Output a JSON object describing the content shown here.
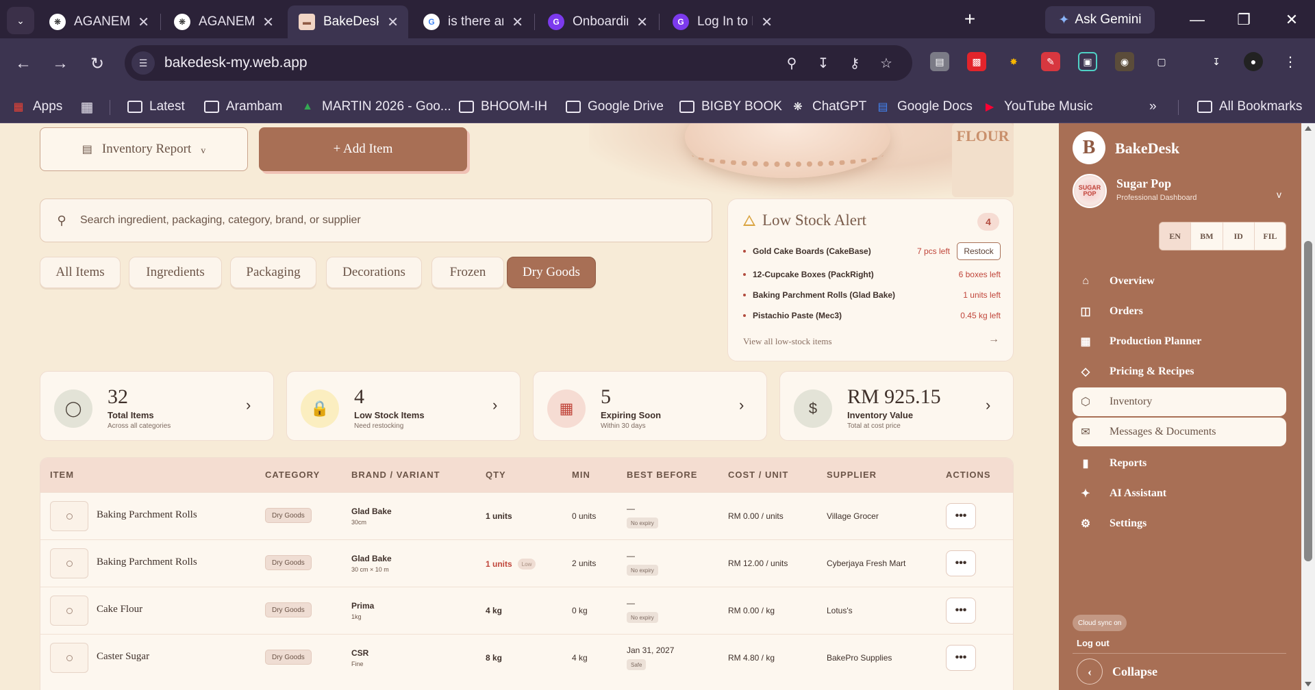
{
  "browser": {
    "tabs": [
      {
        "label": "AGANEM - LAT",
        "favicon": "chatgpt-icon"
      },
      {
        "label": "AGANEM - TH",
        "favicon": "chatgpt-icon"
      },
      {
        "label": "BakeDesk: Bak",
        "favicon": "bakedesk-icon"
      },
      {
        "label": "is there any ai",
        "favicon": "google-icon"
      },
      {
        "label": "Onboarding | C",
        "favicon": "g-icon"
      },
      {
        "label": "Log In to Bake",
        "favicon": "g-icon"
      }
    ],
    "ask_gemini": "Ask Gemini",
    "url": "bakedesk-my.web.app",
    "bookmarks": [
      "Apps",
      "Latest",
      "Arambam",
      "MARTIN 2026 - Goo...",
      "BHOOM-IH",
      "Google Drive",
      "BIGBY BOOK",
      "ChatGPT",
      "Google Docs",
      "YouTube Music",
      "All Bookmarks"
    ]
  },
  "toolbar": {
    "report_label": "Inventory Report",
    "report_caret": "v",
    "add_label": "+ Add Item"
  },
  "hero": {
    "flour_text": "FLOUR"
  },
  "search": {
    "placeholder": "Search ingredient, packaging, category, brand, or supplier"
  },
  "filters": [
    "All Items",
    "Ingredients",
    "Packaging",
    "Decorations",
    "Frozen",
    "Dry Goods"
  ],
  "active_filter": "Dry Goods",
  "low_stock": {
    "title": "Low Stock Alert",
    "count": "4",
    "items": [
      {
        "name": "Gold Cake Boards (CakeBase)",
        "qty": "7 pcs left",
        "action": "Restock"
      },
      {
        "name": "12-Cupcake Boxes (PackRight)",
        "qty": "6 boxes left"
      },
      {
        "name": "Baking Parchment Rolls (Glad Bake)",
        "qty": "1 units left"
      },
      {
        "name": "Pistachio Paste (Mec3)",
        "qty": "0.45 kg left"
      }
    ],
    "view_all": "View all low-stock items",
    "arrow": "→"
  },
  "stats": [
    {
      "value": "32",
      "label": "Total Items",
      "sub": "Across all categories",
      "icon": "box-icon",
      "color": "#e3e3d7"
    },
    {
      "value": "4",
      "label": "Low Stock Items",
      "sub": "Need restocking",
      "icon": "lock-icon",
      "color": "#fbeec0"
    },
    {
      "value": "5",
      "label": "Expiring Soon",
      "sub": "Within 30 days",
      "icon": "calendar-icon",
      "color": "#f6dcd3"
    },
    {
      "value": "RM 925.15",
      "label": "Inventory Value",
      "sub": "Total at cost price",
      "icon": "dollar-icon",
      "color": "#e3e3d7"
    }
  ],
  "table": {
    "headers": [
      "ITEM",
      "CATEGORY",
      "BRAND / VARIANT",
      "QTY",
      "MIN",
      "BEST BEFORE",
      "COST / UNIT",
      "SUPPLIER",
      "ACTIONS"
    ],
    "rows": [
      {
        "item": "Baking Parchment Rolls",
        "category": "Dry Goods",
        "brand": "Glad Bake",
        "variant": "30cm",
        "qty": "1 units",
        "low": "",
        "min": "0 units",
        "date": "—",
        "expiry": "No expiry",
        "cost": "RM 0.00 / units",
        "supplier": "Village Grocer"
      },
      {
        "item": "Baking Parchment Rolls",
        "category": "Dry Goods",
        "brand": "Glad Bake",
        "variant": "30 cm × 10 m",
        "qty": "1 units",
        "low": "Low",
        "min": "2 units",
        "date": "—",
        "expiry": "No expiry",
        "cost": "RM 12.00 / units",
        "supplier": "Cyberjaya Fresh Mart"
      },
      {
        "item": "Cake Flour",
        "category": "Dry Goods",
        "brand": "Prima",
        "variant": "1kg",
        "qty": "4 kg",
        "low": "",
        "min": "0 kg",
        "date": "—",
        "expiry": "No expiry",
        "cost": "RM 0.00 / kg",
        "supplier": "Lotus's"
      },
      {
        "item": "Caster Sugar",
        "category": "Dry Goods",
        "brand": "CSR",
        "variant": "Fine",
        "qty": "8 kg",
        "low": "",
        "min": "4 kg",
        "date": "Jan 31, 2027",
        "expiry": "Safe",
        "cost": "RM 4.80 / kg",
        "supplier": "BakePro Supplies"
      }
    ],
    "action_glyph": "•••"
  },
  "sidebar": {
    "logo": "B",
    "brand": "BakeDesk",
    "avatar_text": "SUGAR POP",
    "user": "Sugar Pop",
    "role": "Professional Dashboard",
    "caret": "v",
    "languages": [
      "EN",
      "BM",
      "ID",
      "FIL"
    ],
    "active_language": "EN",
    "nav": [
      {
        "label": "Overview",
        "icon": "home-icon",
        "glyph": "⌂"
      },
      {
        "label": "Orders",
        "icon": "bag-icon",
        "glyph": "◫"
      },
      {
        "label": "Production Planner",
        "icon": "calendar-icon",
        "glyph": "▦"
      },
      {
        "label": "Pricing & Recipes",
        "icon": "tag-icon",
        "glyph": "◇"
      },
      {
        "label": "Inventory",
        "icon": "box-icon",
        "glyph": "⬡"
      },
      {
        "label": "Messages & Documents",
        "icon": "mail-icon",
        "glyph": "✉"
      },
      {
        "label": "Reports",
        "icon": "bar-chart-icon",
        "glyph": "▮"
      },
      {
        "label": "AI Assistant",
        "icon": "sparkle-icon",
        "glyph": "✦"
      },
      {
        "label": "Settings",
        "icon": "gear-icon",
        "glyph": "⚙"
      }
    ],
    "active_nav": [
      "Inventory",
      "Messages & Documents"
    ],
    "sync": "Cloud sync on",
    "logout": "Log out",
    "collapse": "Collapse"
  }
}
